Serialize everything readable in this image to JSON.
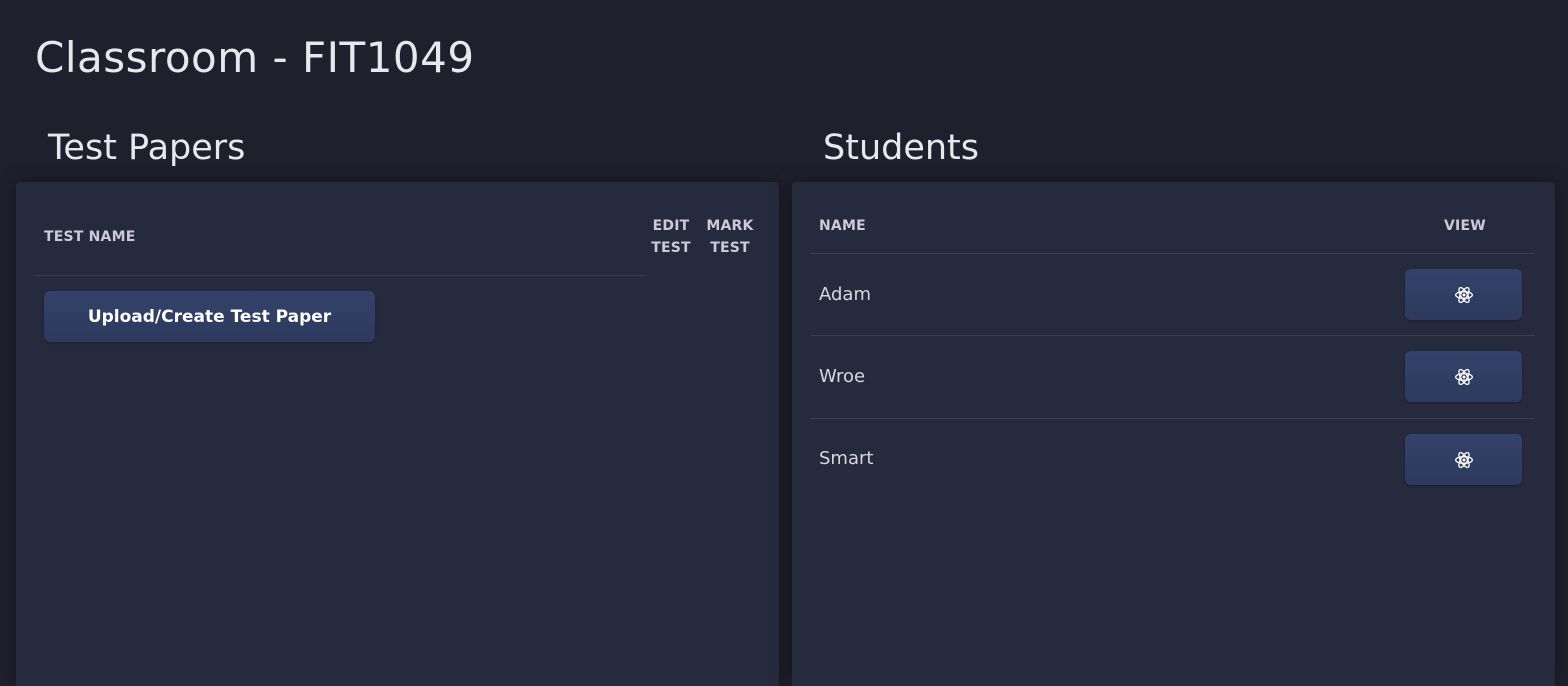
{
  "page": {
    "title": "Classroom - FIT1049"
  },
  "test_papers": {
    "section_title": "Test Papers",
    "columns": {
      "test_name": "TEST NAME",
      "edit_test": [
        "EDIT",
        "TEST"
      ],
      "mark_test": [
        "MARK",
        "TEST"
      ]
    },
    "upload_button_label": "Upload/Create Test Paper"
  },
  "students": {
    "section_title": "Students",
    "columns": {
      "name": "NAME",
      "view": "VIEW"
    },
    "rows": [
      {
        "name": "Adam",
        "view_icon": "atom-icon"
      },
      {
        "name": "Wroe",
        "view_icon": "atom-icon"
      },
      {
        "name": "Smart",
        "view_icon": "atom-icon"
      }
    ]
  },
  "colors": {
    "page_background": "#1f1f2e",
    "panel_background": "#262a3d",
    "button_background": "#2f3c62",
    "text_primary": "#e8e8ec",
    "header_text": "#c9cbd6"
  }
}
